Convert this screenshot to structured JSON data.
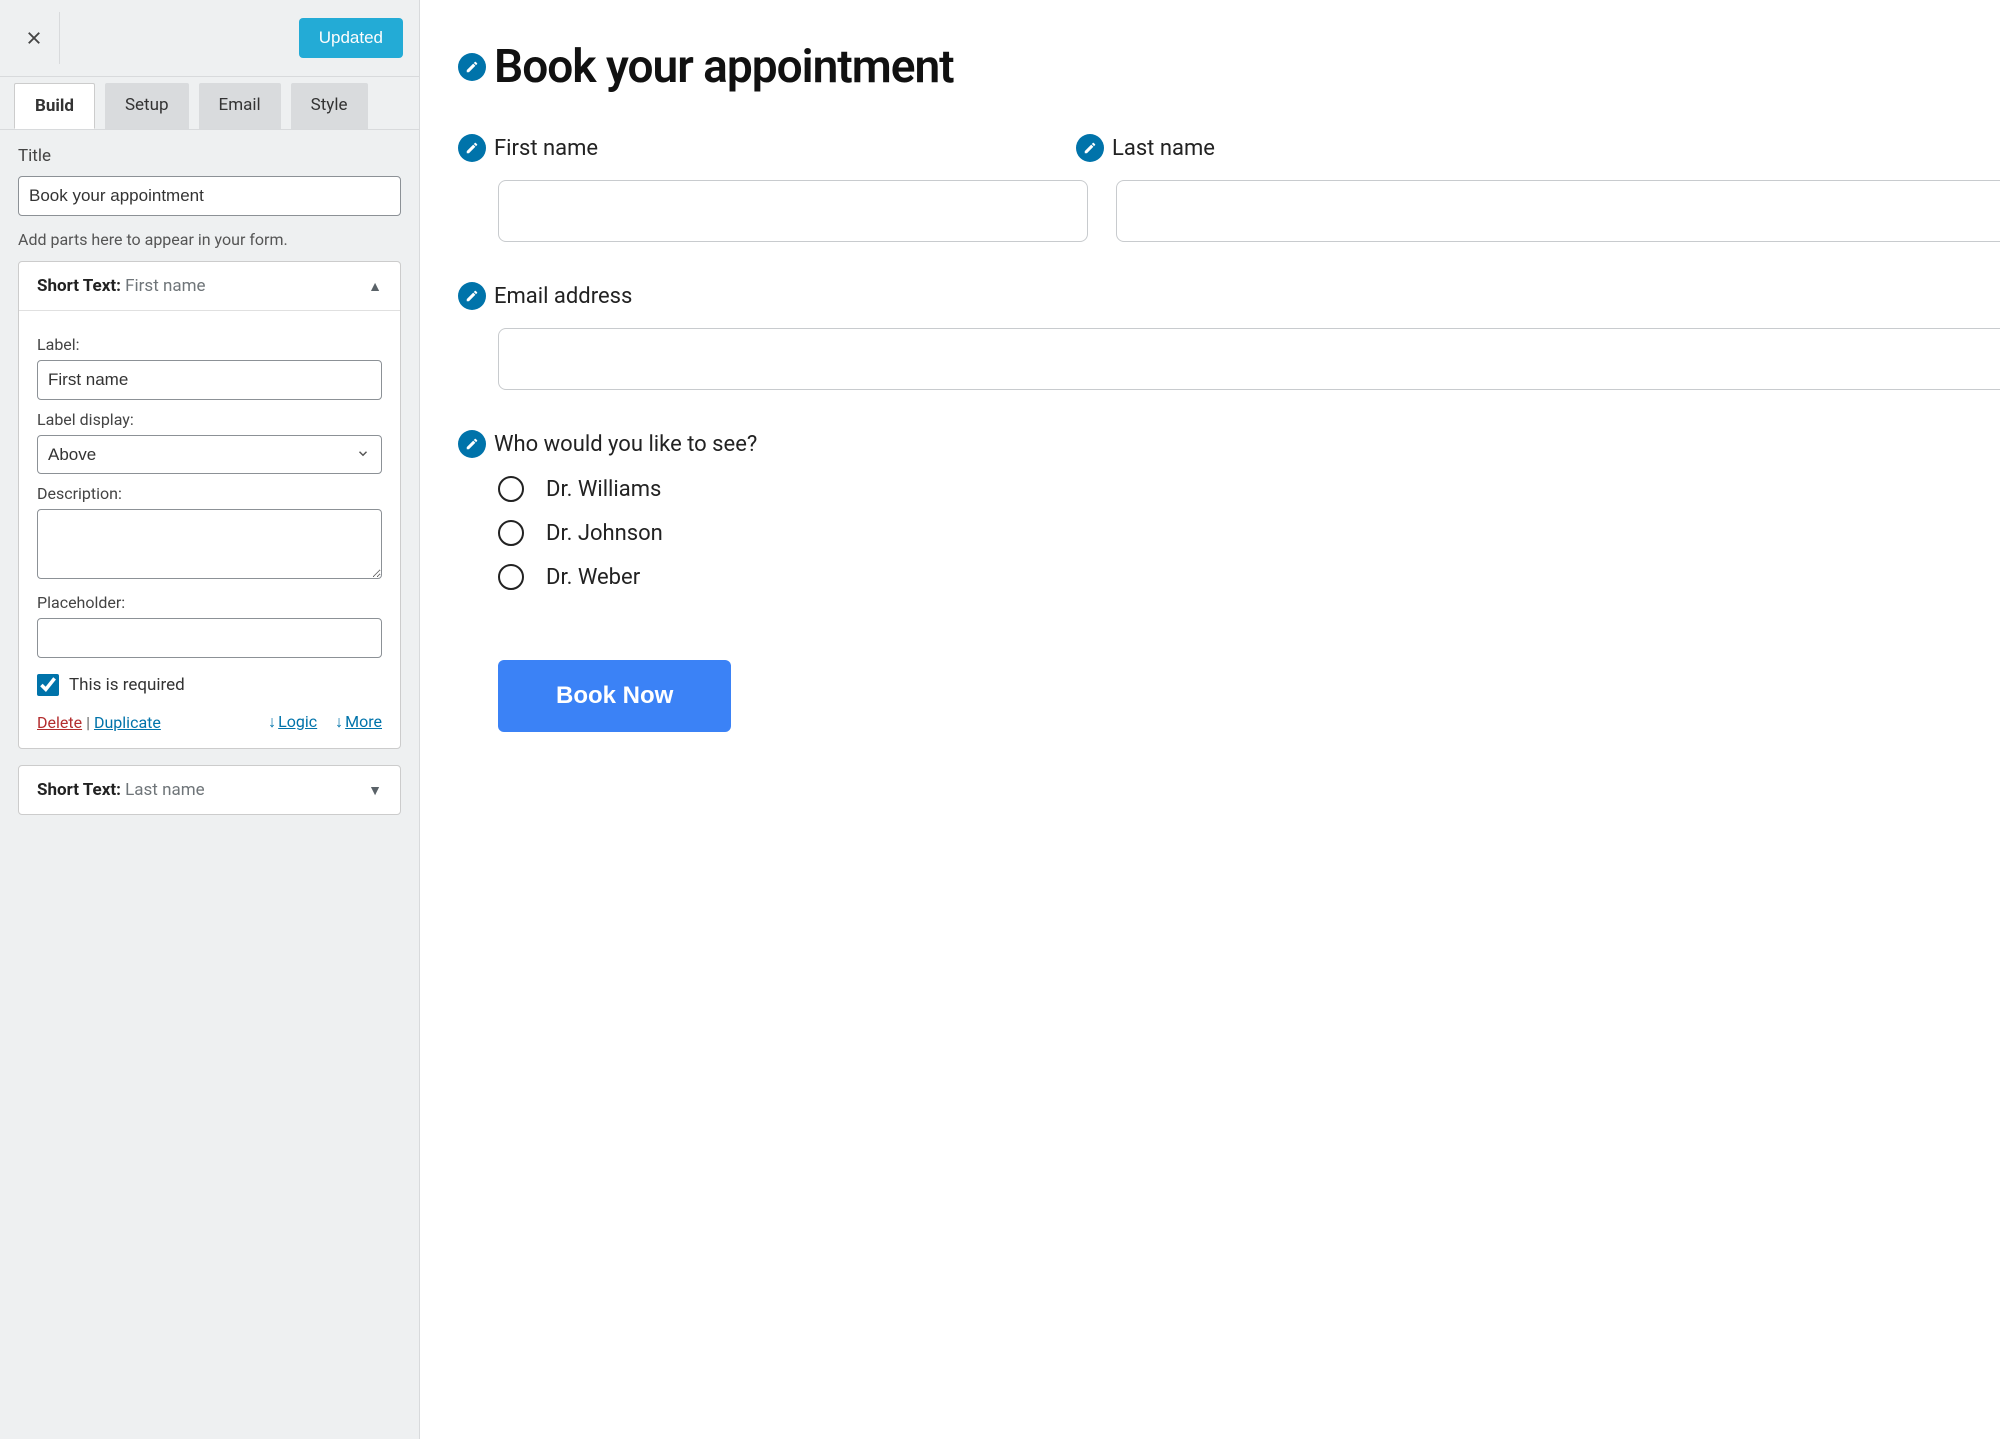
{
  "toolbar": {
    "updated_label": "Updated"
  },
  "tabs": {
    "build": "Build",
    "setup": "Setup",
    "email": "Email",
    "style": "Style"
  },
  "title_section": {
    "label": "Title",
    "value": "Book your appointment",
    "hint": "Add parts here to appear in your form."
  },
  "part_expanded": {
    "type_label": "Short Text:",
    "name": "First name",
    "label_label": "Label:",
    "label_value": "First name",
    "label_display_label": "Label display:",
    "label_display_value": "Above",
    "description_label": "Description:",
    "description_value": "",
    "placeholder_label": "Placeholder:",
    "placeholder_value": "",
    "required_label": "This is required",
    "delete": "Delete",
    "duplicate": "Duplicate",
    "logic": "Logic",
    "more": "More"
  },
  "part_collapsed": {
    "type_label": "Short Text:",
    "name": "Last name"
  },
  "preview": {
    "form_title": "Book your appointment",
    "first_name_label": "First name",
    "last_name_label": "Last name",
    "email_label": "Email address",
    "radio_label": "Who would you like to see?",
    "radio_options": [
      "Dr. Williams",
      "Dr. Johnson",
      "Dr. Weber"
    ],
    "submit_label": "Book Now"
  }
}
